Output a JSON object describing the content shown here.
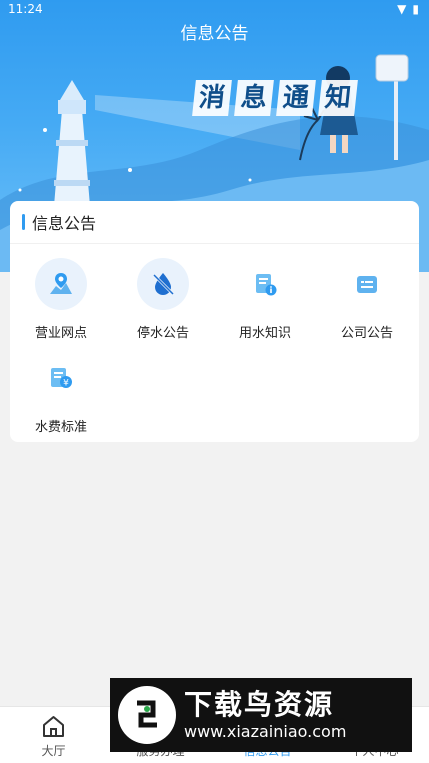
{
  "status": {
    "time": "11:24"
  },
  "header": {
    "title": "信息公告"
  },
  "banner": {
    "chars": [
      "消",
      "息",
      "通",
      "知"
    ]
  },
  "card": {
    "title": "信息公告",
    "items": [
      {
        "label": "营业网点",
        "icon": "map-pin-icon"
      },
      {
        "label": "停水公告",
        "icon": "water-off-icon"
      },
      {
        "label": "用水知识",
        "icon": "knowledge-doc-icon"
      },
      {
        "label": "公司公告",
        "icon": "notice-board-icon"
      },
      {
        "label": "水费标准",
        "icon": "fee-standard-icon"
      }
    ]
  },
  "tabbar": {
    "items": [
      {
        "label": "大厅",
        "icon": "home-icon",
        "active": false
      },
      {
        "label": "服务办理",
        "icon": "service-icon",
        "active": false
      },
      {
        "label": "信息公告",
        "icon": "notice-icon",
        "active": true
      },
      {
        "label": "个人中心",
        "icon": "user-icon",
        "active": false
      }
    ]
  },
  "watermark": {
    "title": "下载鸟资源",
    "url": "www.xiazainiao.com"
  },
  "colors": {
    "primary": "#2f9bf0",
    "hero_top": "#2f9bf0",
    "hero_bottom": "#6dc0f8",
    "page_bg": "#f2f2f2"
  }
}
